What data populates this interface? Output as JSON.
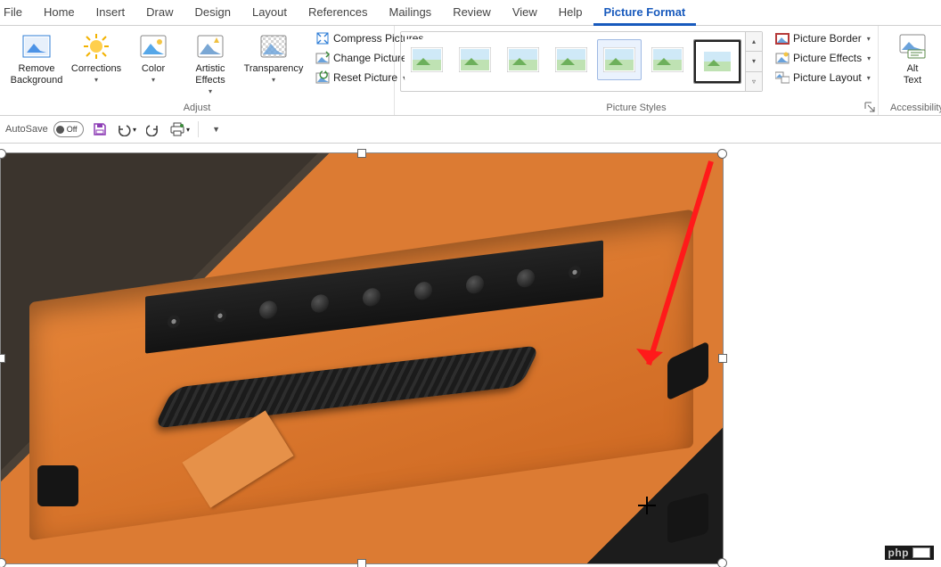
{
  "tabs": {
    "file": "File",
    "home": "Home",
    "insert": "Insert",
    "draw": "Draw",
    "design": "Design",
    "layout": "Layout",
    "references": "References",
    "mailings": "Mailings",
    "review": "Review",
    "view": "View",
    "help": "Help",
    "picture_format": "Picture Format"
  },
  "groups": {
    "adjust": {
      "label": "Adjust",
      "remove_bg": "Remove\nBackground",
      "corrections": "Corrections",
      "color": "Color",
      "artistic": "Artistic\nEffects",
      "transparency": "Transparency",
      "compress": "Compress Pictures",
      "change": "Change Picture",
      "reset": "Reset Picture"
    },
    "picture_styles": {
      "label": "Picture Styles",
      "border": "Picture Border",
      "effects": "Picture Effects",
      "layout": "Picture Layout"
    },
    "accessibility": {
      "label": "Accessibility",
      "alt_text": "Alt\nText"
    }
  },
  "qat": {
    "autosave_label": "AutoSave",
    "autosave_state": "Off"
  },
  "watermark": "php"
}
